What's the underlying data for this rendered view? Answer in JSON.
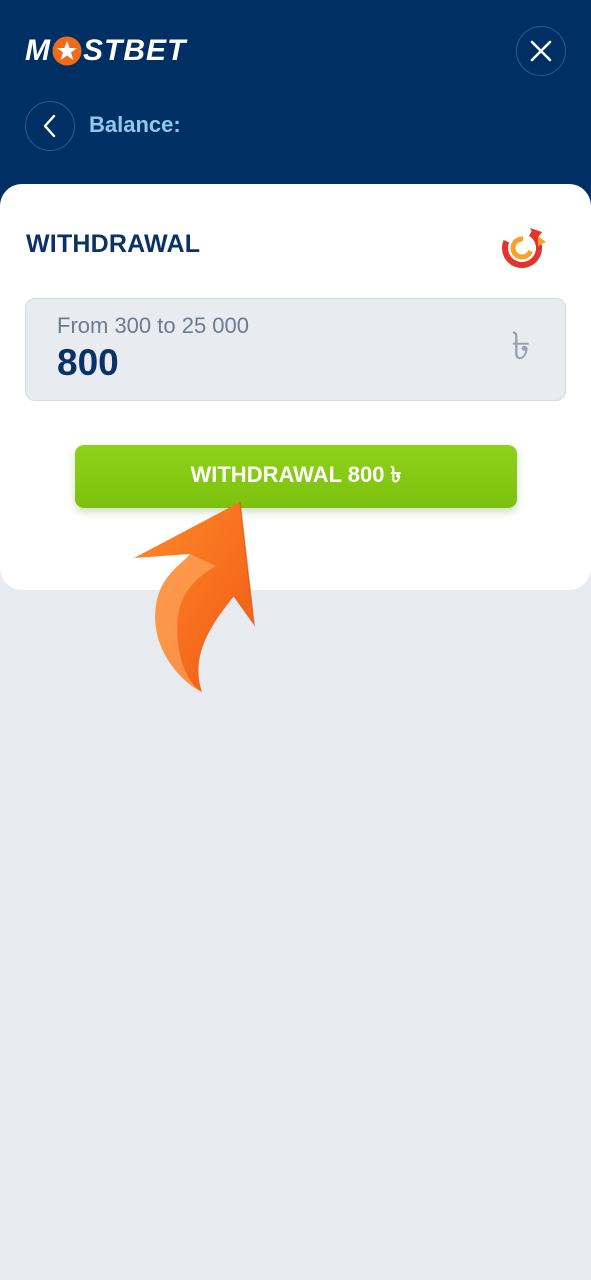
{
  "app": {
    "logo_text_left": "M",
    "logo_text_right": "STBET",
    "brand_color": "#002f64",
    "accent_color": "#f26a1b"
  },
  "header": {
    "balance_label": "Balance:"
  },
  "withdrawal": {
    "title": "WITHDRAWAL",
    "amount_hint": "From 300 to 25 000",
    "amount_value": "800",
    "currency_symbol": "৳",
    "submit_label": "WITHDRAWAL 800 ৳",
    "button_color": "#86ca12"
  },
  "icons": {
    "close": "close-icon",
    "back": "chevron-left-icon",
    "method": "payment-method-logo",
    "overlay": "orange-arrow-pointer"
  }
}
